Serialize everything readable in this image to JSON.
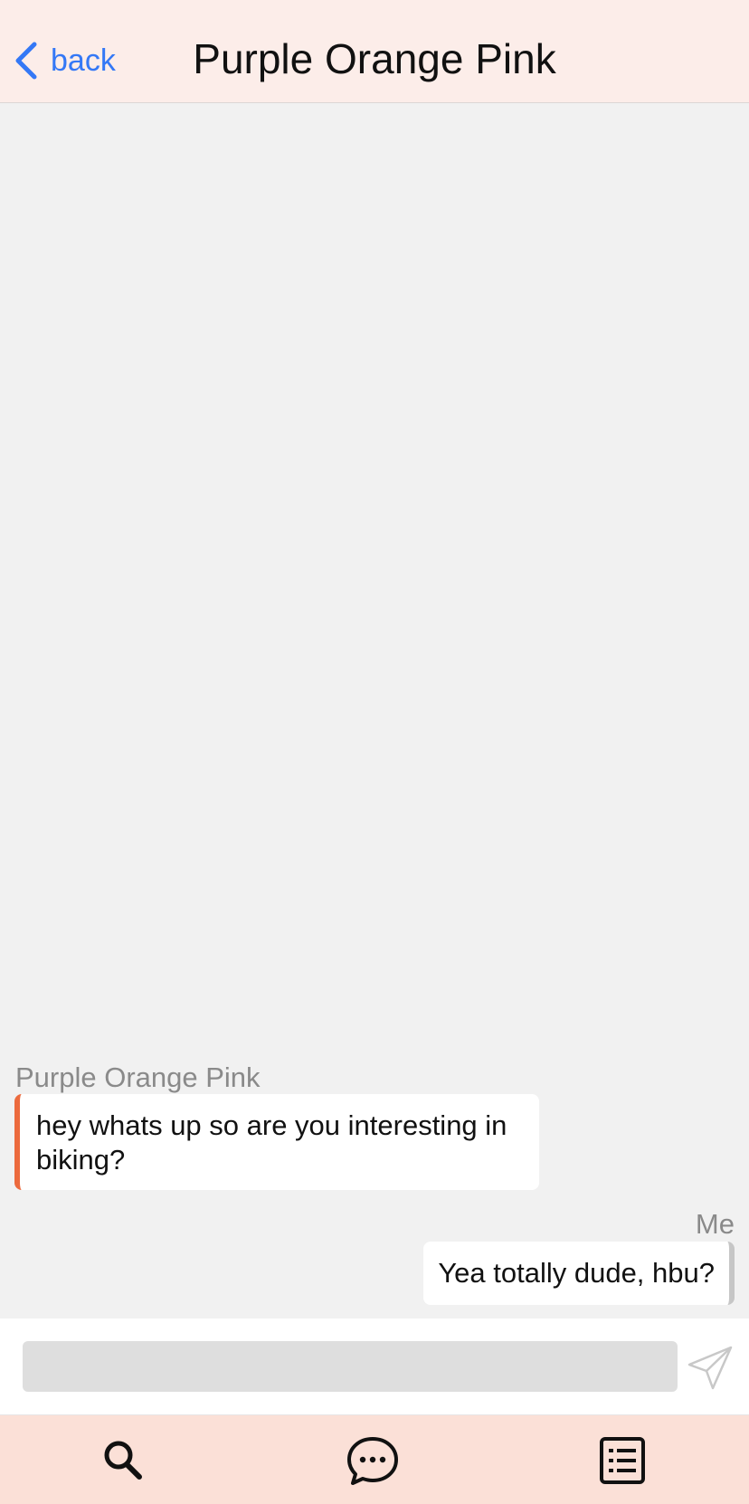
{
  "header": {
    "back_label": "back",
    "title": "Purple Orange Pink"
  },
  "messages": [
    {
      "sender": "Purple Orange Pink",
      "text": "hey whats up so are you interesting in biking?",
      "side": "left",
      "accent": "#ec6a3d"
    },
    {
      "sender": "Me",
      "text": "Yea totally dude, hbu?",
      "side": "right",
      "accent": "#c6c6c6"
    }
  ],
  "compose": {
    "value": "",
    "send_icon": "send-icon"
  },
  "tabbar": {
    "items": [
      {
        "icon": "search-icon"
      },
      {
        "icon": "chat-bubble-icon"
      },
      {
        "icon": "list-icon"
      }
    ]
  },
  "colors": {
    "header_bg": "#fcede9",
    "tabbar_bg": "#fbe0d7",
    "link": "#3478f6",
    "incoming_accent": "#ec6a3d",
    "outgoing_accent": "#c6c6c6"
  }
}
